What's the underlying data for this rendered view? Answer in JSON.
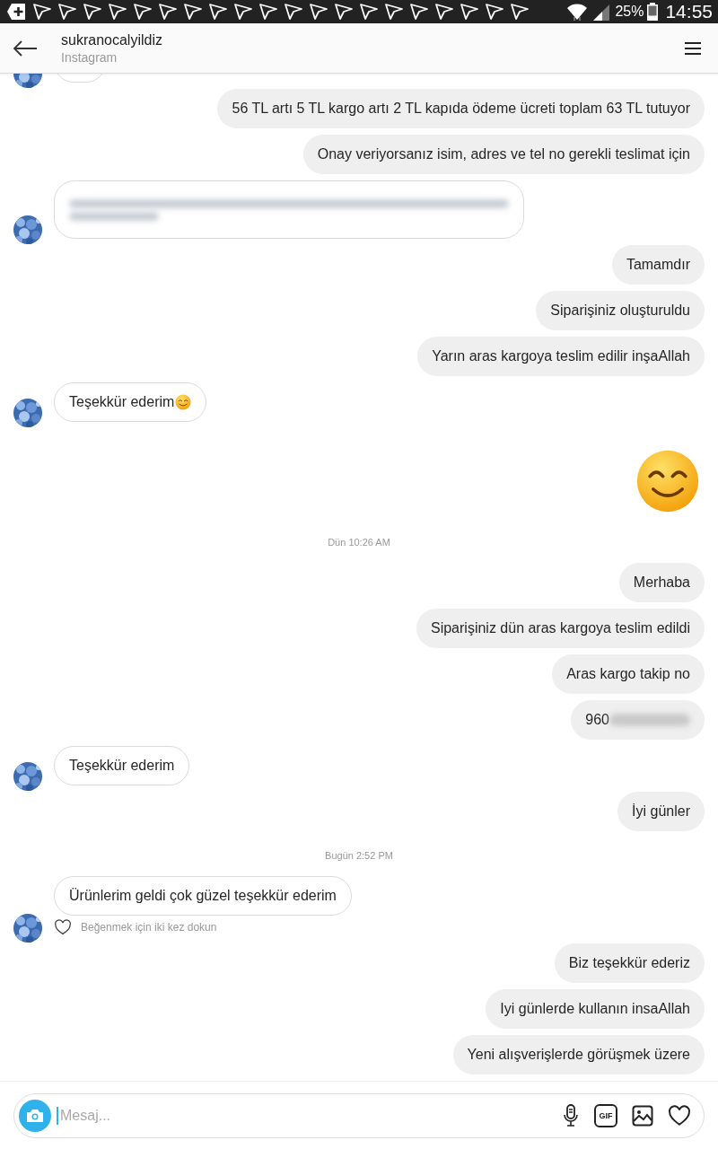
{
  "status_bar": {
    "battery": "25%",
    "time": "14:55"
  },
  "header": {
    "title": "sukranocalyildiz",
    "subtitle": "Instagram"
  },
  "messages": [
    {
      "kind": "partial"
    },
    {
      "kind": "outgoing",
      "text": "56 TL artı 5 TL kargo artı 2 TL kapıda ödeme ücreti toplam 63 TL tutuyor"
    },
    {
      "kind": "outgoing",
      "text": "Onay veriyorsanız isim, adres ve tel no gerekli teslimat için"
    },
    {
      "kind": "redacted_incoming"
    },
    {
      "kind": "outgoing",
      "text": "Tamamdır"
    },
    {
      "kind": "outgoing",
      "text": "Siparişiniz oluşturuldu"
    },
    {
      "kind": "outgoing",
      "text": "Yarın aras kargoya teslim edilir inşaAllah"
    },
    {
      "kind": "incoming",
      "text": "Teşekkür ederim",
      "emoji": true
    },
    {
      "kind": "big_emoji"
    },
    {
      "kind": "timestamp",
      "text": "Dün 10:26 AM"
    },
    {
      "kind": "outgoing",
      "text": "Merhaba"
    },
    {
      "kind": "outgoing",
      "text": "Siparişiniz dün aras kargoya teslim edildi"
    },
    {
      "kind": "outgoing",
      "text": "Aras kargo takip no"
    },
    {
      "kind": "outgoing",
      "text": "960",
      "redacted": true
    },
    {
      "kind": "incoming",
      "text": "Teşekkür ederim"
    },
    {
      "kind": "outgoing",
      "text": "İyi günler"
    },
    {
      "kind": "timestamp",
      "text": "Bugün 2:52 PM"
    },
    {
      "kind": "incoming",
      "text": "Ürünlerim geldi çok güzel teşekkür ederim",
      "like_hint": "Beğenmek için iki kez dokun"
    },
    {
      "kind": "outgoing",
      "text": "Biz teşekkür ederiz"
    },
    {
      "kind": "outgoing",
      "text": "Iyi günlerde kullanın insaAllah"
    },
    {
      "kind": "outgoing",
      "text": "Yeni alışverişlerde görüşmek üzere"
    }
  ],
  "composer": {
    "placeholder": "Mesaj...",
    "gif_label": "GIF"
  }
}
